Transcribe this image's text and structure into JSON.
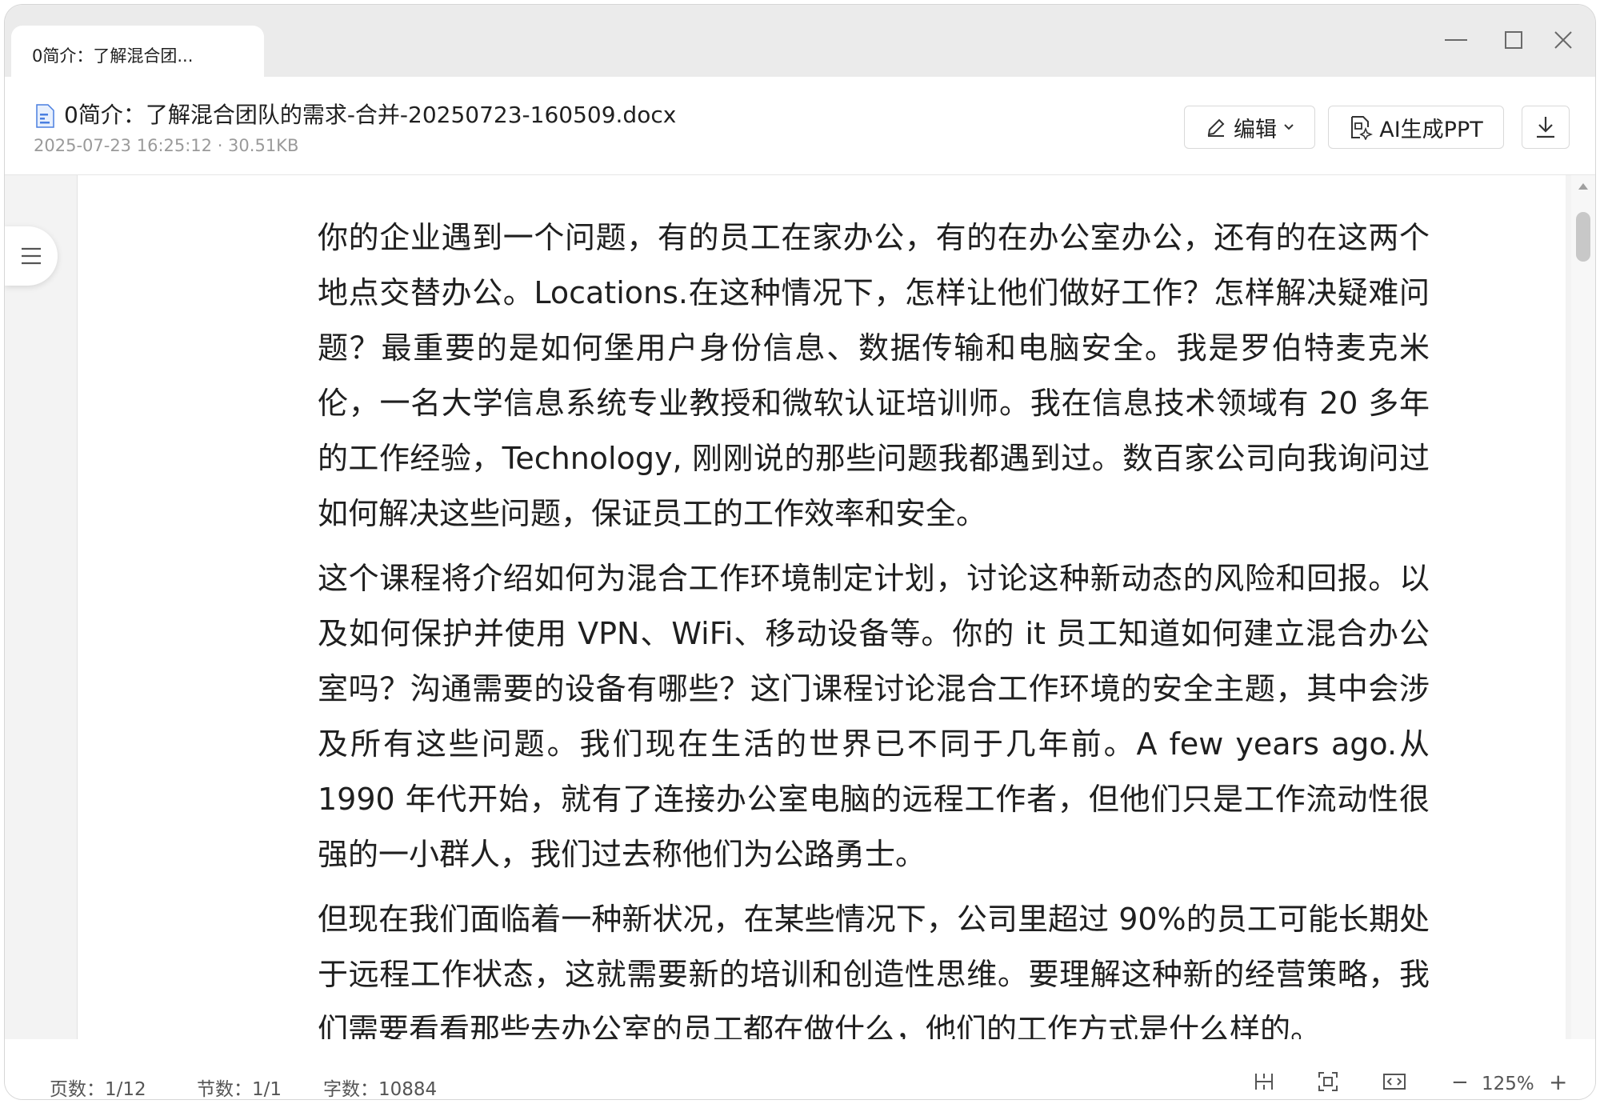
{
  "tab": {
    "title": "0简介：了解混合团..."
  },
  "window_controls": {
    "minimize": "minimize-icon",
    "maximize": "maximize-icon",
    "close": "close-icon"
  },
  "document": {
    "title": "0简介：了解混合团队的需求-合并-20250723-160509.docx",
    "meta": "2025-07-23 16:25:12 · 30.51KB"
  },
  "toolbar": {
    "edit_label": "编辑",
    "ai_ppt_label": "AI生成PPT",
    "download_icon": "download-icon"
  },
  "content": {
    "paragraphs": [
      "你的企业遇到一个问题，有的员工在家办公，有的在办公室办公，还有的在这两个地点交替办公。Locations.在这种情况下，怎样让他们做好工作？怎样解决疑难问题？最重要的是如何堡用户身份信息、数据传输和电脑安全。我是罗伯特麦克米伦，一名大学信息系统专业教授和微软认证培训师。我在信息技术领域有 20 多年的工作经验，Technology, 刚刚说的那些问题我都遇到过。数百家公司向我询问过如何解决这些问题，保证员工的工作效率和安全。",
      "这个课程将介绍如何为混合工作环境制定计划，讨论这种新动态的风险和回报。以及如何保护并使用 VPN、WiFi、移动设备等。你的 it 员工知道如何建立混合办公室吗？沟通需要的设备有哪些？这门课程讨论混合工作环境的安全主题，其中会涉及所有这些问题。我们现在生活的世界已不同于几年前。A few years ago.从 1990 年代开始，就有了连接办公室电脑的远程工作者，但他们只是工作流动性很强的一小群人，我们过去称他们为公路勇士。",
      "但现在我们面临着一种新状况，在某些情况下，公司里超过 90%的员工可能长期处于远程工作状态，这就需要新的培训和创造性思维。要理解这种新的经营策略，我们需要看看那些去办公室的员工都在做什么，他们的工作方式是什么样的。"
    ]
  },
  "statusbar": {
    "pages": "页数：1/12",
    "sections": "节数：1/1",
    "words": "字数：10884",
    "zoom": "125%",
    "zoom_out": "−",
    "zoom_in": "+"
  }
}
